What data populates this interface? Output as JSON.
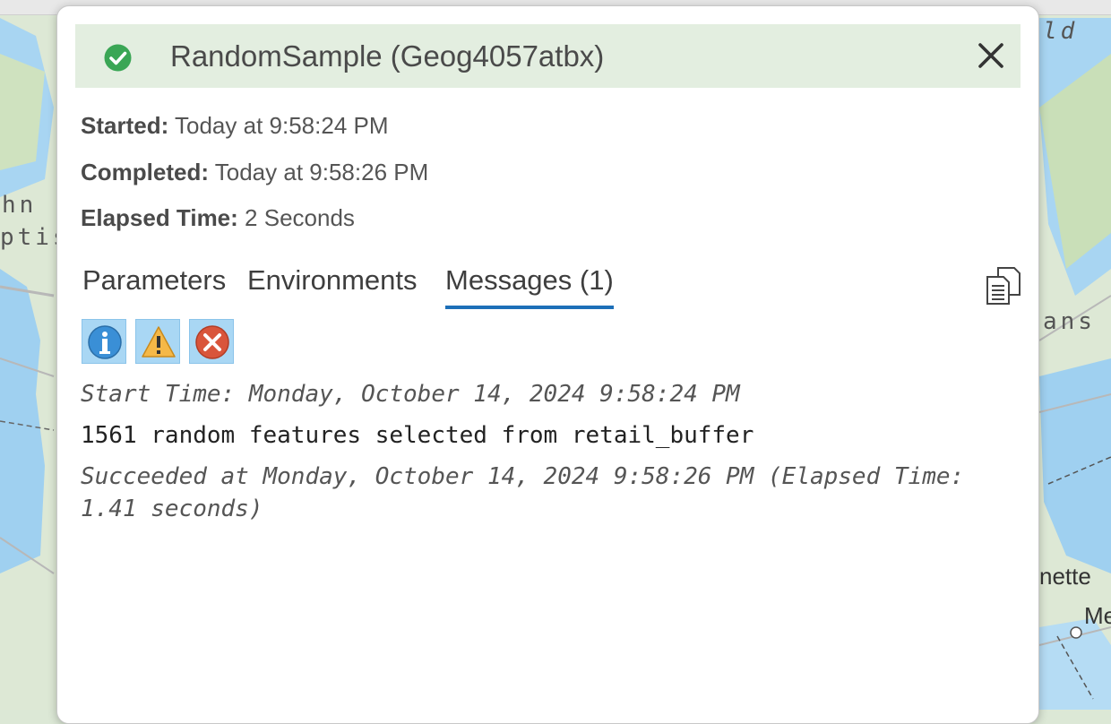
{
  "map": {
    "labels": [
      "ld",
      "hn",
      "ptis",
      "ans",
      "nette",
      "Me"
    ]
  },
  "dialog": {
    "title": "RandomSample (Geog4057atbx)",
    "status_icon": "check-circle-icon",
    "close_icon": "close-icon",
    "started_label": "Started:",
    "started_value": "Today at 9:58:24 PM",
    "completed_label": "Completed:",
    "completed_value": "Today at 9:58:26 PM",
    "elapsed_label": "Elapsed Time:",
    "elapsed_value": "2 Seconds",
    "tabs": [
      {
        "label": "Parameters",
        "active": false
      },
      {
        "label": "Environments",
        "active": false
      },
      {
        "label": "Messages (1)",
        "active": true
      }
    ],
    "filters": [
      {
        "icon": "info-icon"
      },
      {
        "icon": "warning-icon"
      },
      {
        "icon": "error-icon"
      }
    ],
    "messages": [
      {
        "text": "Start Time: Monday, October 14, 2024 9:58:24 PM",
        "style": "italic"
      },
      {
        "text": "1561 random features selected from retail_buffer",
        "style": "normal"
      },
      {
        "text": "Succeeded at Monday, October 14, 2024 9:58:26 PM (Elapsed Time:",
        "style": "italic"
      },
      {
        "text": "1.41 seconds)",
        "style": "italic"
      }
    ],
    "colors": {
      "header_bg": "#e3eee0",
      "success_green": "#3aa655",
      "tab_underline": "#1d6fb8",
      "filter_bg": "#a9d7f4"
    }
  }
}
